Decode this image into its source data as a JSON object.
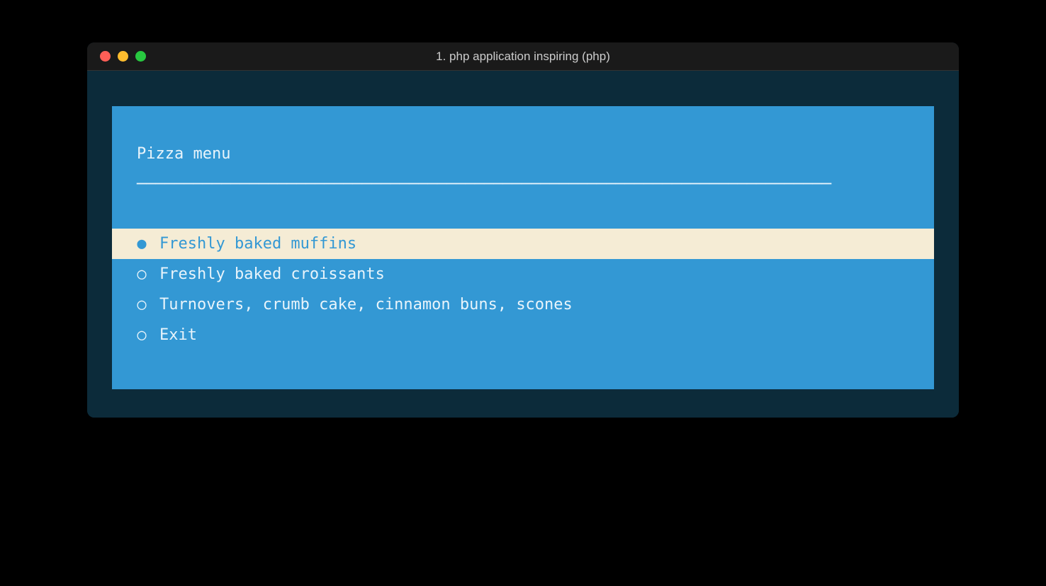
{
  "window": {
    "title": "1. php application inspiring (php)"
  },
  "menu": {
    "title": "Pizza menu",
    "divider": "──────────────────────────────────────────────────────────────────────────",
    "items": [
      {
        "label": "Freshly baked muffins",
        "selected": true
      },
      {
        "label": "Freshly baked croissants",
        "selected": false
      },
      {
        "label": "Turnovers, crumb cake, cinnamon buns, scones",
        "selected": false
      },
      {
        "label": "Exit",
        "selected": false
      }
    ]
  },
  "colors": {
    "terminal_bg": "#0c2b3a",
    "panel_bg": "#3398d4",
    "selected_bg": "#f5ecd5",
    "selected_fg": "#3398d4",
    "text": "#e8f4fb"
  }
}
